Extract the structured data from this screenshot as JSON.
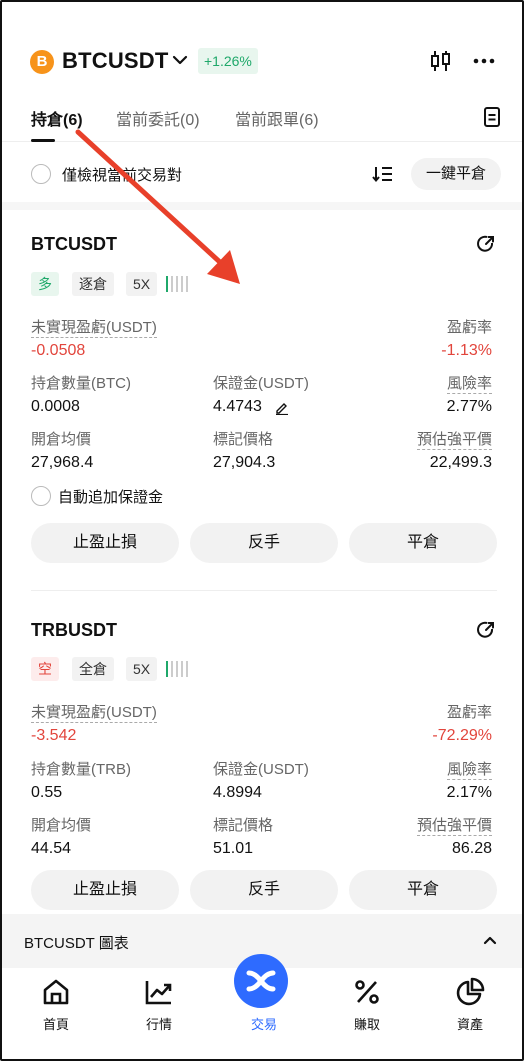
{
  "header": {
    "coin_symbol": "B",
    "pair": "BTCUSDT",
    "change": "+1.26%"
  },
  "tabs": [
    {
      "label": "持倉(6)",
      "active": true
    },
    {
      "label": "當前委託(0)",
      "active": false
    },
    {
      "label": "當前跟單(6)",
      "active": false
    }
  ],
  "filter": {
    "label": "僅檢視當前交易對",
    "close_all": "一鍵平倉"
  },
  "positions": [
    {
      "symbol": "BTCUSDT",
      "side": "多",
      "margin_mode": "逐倉",
      "leverage": "5X",
      "pnl_label": "未實現盈虧(USDT)",
      "pnl_value": "-0.0508",
      "roe_label": "盈虧率",
      "roe_value": "-1.13%",
      "size_label": "持倉數量(BTC)",
      "size_value": "0.0008",
      "margin_label": "保證金(USDT)",
      "margin_value": "4.4743",
      "risk_label": "風險率",
      "risk_value": "2.77%",
      "entry_label": "開倉均價",
      "entry_value": "27,968.4",
      "mark_label": "標記價格",
      "mark_value": "27,904.3",
      "liq_label": "預估強平價",
      "liq_value": "22,499.3",
      "auto_margin": "自動追加保證金",
      "btn_tpsl": "止盈止損",
      "btn_reverse": "反手",
      "btn_close": "平倉"
    },
    {
      "symbol": "TRBUSDT",
      "side": "空",
      "margin_mode": "全倉",
      "leverage": "5X",
      "pnl_label": "未實現盈虧(USDT)",
      "pnl_value": "-3.542",
      "roe_label": "盈虧率",
      "roe_value": "-72.29%",
      "size_label": "持倉數量(TRB)",
      "size_value": "0.55",
      "margin_label": "保證金(USDT)",
      "margin_value": "4.8994",
      "risk_label": "風險率",
      "risk_value": "2.17%",
      "entry_label": "開倉均價",
      "entry_value": "44.54",
      "mark_label": "標記價格",
      "mark_value": "51.01",
      "liq_label": "預估強平價",
      "liq_value": "86.28",
      "btn_tpsl": "止盈止損",
      "btn_reverse": "反手",
      "btn_close": "平倉"
    }
  ],
  "chart_bar": {
    "label": "BTCUSDT 圖表"
  },
  "nav": [
    {
      "label": "首頁",
      "icon": "home-icon",
      "active": false
    },
    {
      "label": "行情",
      "icon": "market-chart-icon",
      "active": false
    },
    {
      "label": "交易",
      "icon": "trade-icon",
      "active": true
    },
    {
      "label": "賺取",
      "icon": "percent-icon",
      "active": false
    },
    {
      "label": "資產",
      "icon": "pie-chart-icon",
      "active": false
    }
  ],
  "colors": {
    "green": "#1fa86a",
    "red": "#e2453c",
    "blue": "#2e6bff",
    "btc_orange": "#f7931a",
    "arrow": "#e8402a"
  }
}
